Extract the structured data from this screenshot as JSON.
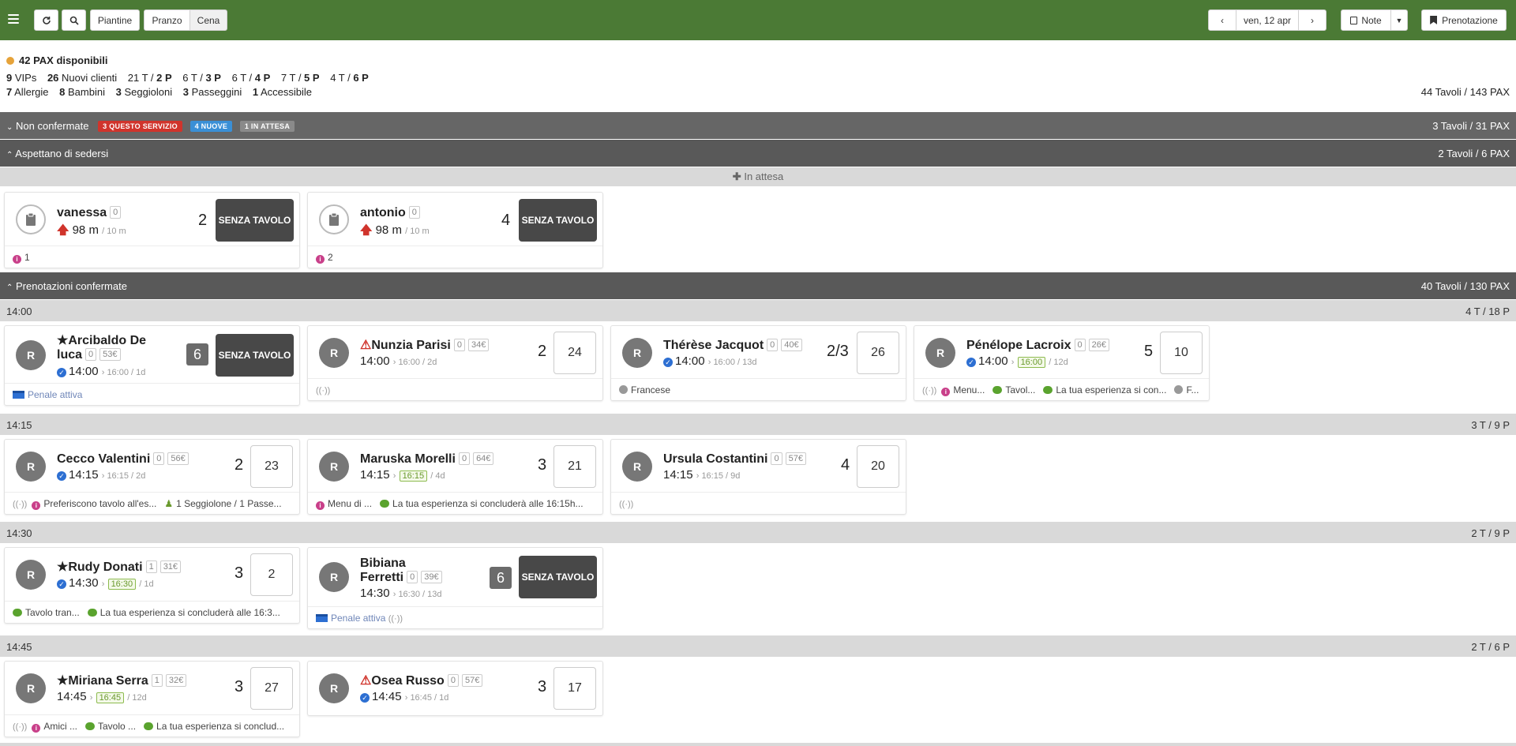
{
  "toolbar": {
    "refresh_icon": "refresh-icon",
    "search_icon": "search-icon",
    "piantine": "Piantine",
    "pranzo": "Pranzo",
    "cena": "Cena",
    "date": "ven, 12 apr",
    "note": "Note",
    "prenotazione": "Prenotazione"
  },
  "summary": {
    "available": "42 PAX disponibili",
    "vips_n": "9",
    "vips": "VIPs",
    "new_n": "26",
    "new": "Nuovi clienti",
    "t2a": "21 T / ",
    "t2b": "2 P",
    "t3a": "6 T / ",
    "t3b": "3 P",
    "t4a": "6 T / ",
    "t4b": "4 P",
    "t5a": "7 T / ",
    "t5b": "5 P",
    "t6a": "4 T / ",
    "t6b": "6 P",
    "allergie_n": "7",
    "allergie": "Allergie",
    "bambini_n": "8",
    "bambini": "Bambini",
    "seggioloni_n": "3",
    "seggioloni": "Seggioloni",
    "passeggini_n": "3",
    "passeggini": "Passeggini",
    "accessibile_n": "1",
    "accessibile": "Accessibile",
    "totals": "44 Tavoli / 143 PAX"
  },
  "sections": {
    "non_confermate": {
      "label": "Non confermate",
      "badge1": "3 QUESTO SERVIZIO",
      "badge2": "4 NUOVE",
      "badge3": "1 IN ATTESA",
      "right": "3 Tavoli / 31 PAX"
    },
    "aspettano": {
      "label": "Aspettano di sedersi",
      "right": "2 Tavoli / 6 PAX"
    },
    "in_attesa": "In attesa",
    "confermate": {
      "label": "Prenotazioni confermate",
      "right": "40 Tavoli / 130 PAX"
    }
  },
  "waiting": [
    {
      "name": "vanessa",
      "tag": "0",
      "time": "98 m",
      "sub": "/ 10 m",
      "pax": "2",
      "table": "SENZA TAVOLO",
      "foot": "1"
    },
    {
      "name": "antonio",
      "tag": "0",
      "time": "98 m",
      "sub": "/ 10 m",
      "pax": "4",
      "table": "SENZA TAVOLO",
      "foot": "2"
    }
  ],
  "slots": [
    {
      "time": "14:00",
      "right": "4 T / 18 P"
    },
    {
      "time": "14:15",
      "right": "3 T / 9 P"
    },
    {
      "time": "14:30",
      "right": "2 T / 9 P"
    },
    {
      "time": "14:45",
      "right": "2 T / 6 P"
    }
  ],
  "cards": {
    "c1": {
      "name1": "Arcibaldo De",
      "name2": "luca",
      "tag1": "0",
      "tag2": "53€",
      "time": "14:00",
      "sub": "› 16:00 / 1d",
      "pax": "6",
      "table": "SENZA TAVOLO",
      "foot": "Penale attiva"
    },
    "c2": {
      "name": "Nunzia Parisi",
      "tag1": "0",
      "tag2": "34€",
      "time": "14:00",
      "sub": "› 16:00 / 2d",
      "pax": "2",
      "table": "24"
    },
    "c3": {
      "name": "Thérèse Jacquot",
      "tag1": "0",
      "tag2": "40€",
      "time": "14:00",
      "sub": "› 16:00 / 13d",
      "pax": "2/3",
      "table": "26",
      "foot": "Francese"
    },
    "c4": {
      "name": "Pénélope Lacroix",
      "tag1": "0",
      "tag2": "26€",
      "time": "14:00",
      "green": "16:00",
      "sub": "/ 12d",
      "pax": "5",
      "table": "10",
      "foot1": "Menu...",
      "foot2": "Tavol...",
      "foot3": "La tua esperienza si con...",
      "foot4": "F..."
    },
    "c5": {
      "name": "Cecco Valentini",
      "tag1": "0",
      "tag2": "56€",
      "time": "14:15",
      "sub": "› 16:15 / 2d",
      "pax": "2",
      "table": "23",
      "foot1": "Preferiscono tavolo all'es...",
      "foot2": "1 Seggiolone / 1 Passe..."
    },
    "c6": {
      "name": "Maruska Morelli",
      "tag1": "0",
      "tag2": "64€",
      "time": "14:15",
      "green": "16:15",
      "sub": "/ 4d",
      "pax": "3",
      "table": "21",
      "foot1": "Menu di ...",
      "foot2": "La tua esperienza si concluderà alle 16:15h..."
    },
    "c7": {
      "name": "Ursula Costantini",
      "tag1": "0",
      "tag2": "57€",
      "time": "14:15",
      "sub": "› 16:15 / 9d",
      "pax": "4",
      "table": "20"
    },
    "c8": {
      "name": "Rudy Donati",
      "tag1": "1",
      "tag2": "31€",
      "time": "14:30",
      "green": "16:30",
      "sub": "/ 1d",
      "pax": "3",
      "table": "2",
      "foot1": "Tavolo tran...",
      "foot2": "La tua esperienza si concluderà alle 16:3..."
    },
    "c9": {
      "name1": "Bibiana",
      "name2": "Ferretti",
      "tag1": "0",
      "tag2": "39€",
      "time": "14:30",
      "sub": "› 16:30 / 13d",
      "pax": "6",
      "table": "SENZA TAVOLO",
      "foot": "Penale attiva"
    },
    "c10": {
      "name": "Miriana Serra",
      "tag1": "1",
      "tag2": "32€",
      "time": "14:45",
      "green": "16:45",
      "sub": "/ 12d",
      "pax": "3",
      "table": "27",
      "foot1": "Amici ...",
      "foot2": "Tavolo ...",
      "foot3": "La tua esperienza si conclud..."
    },
    "c11": {
      "name": "Osea Russo",
      "tag1": "0",
      "tag2": "57€",
      "time": "14:45",
      "sub": "› 16:45 / 1d",
      "pax": "3",
      "table": "17"
    }
  },
  "colors": {
    "topbar": "#4b7a35",
    "section_dark": "#666666",
    "badge_red": "#d0342c",
    "badge_blue": "#3a8fd6",
    "badge_gray": "#8a8a8a"
  }
}
